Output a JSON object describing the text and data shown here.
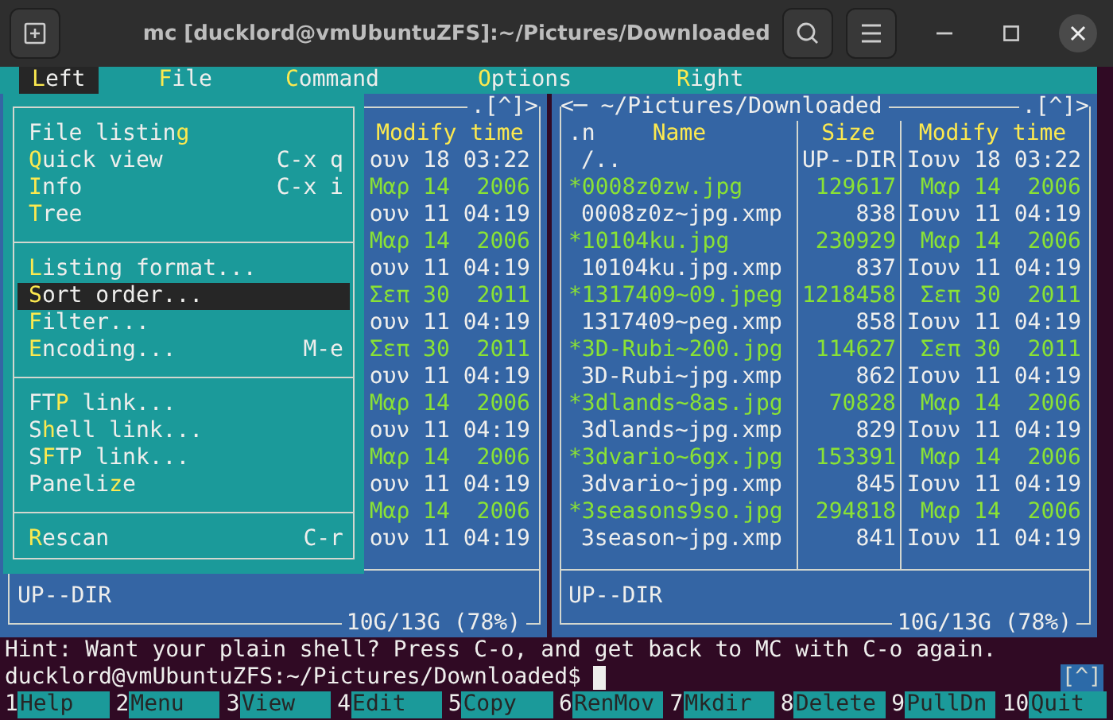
{
  "window": {
    "title": "mc [ducklord@vmUbuntuZFS]:~/Pictures/Downloaded"
  },
  "menu_bar": [
    {
      "hotkey": "L",
      "after": "eft",
      "selected": true
    },
    {
      "hotkey": "F",
      "after": "ile",
      "selected": false
    },
    {
      "hotkey": "C",
      "after": "ommand",
      "selected": false
    },
    {
      "hotkey": "O",
      "after": "ptions",
      "selected": false
    },
    {
      "hotkey": "R",
      "after": "ight",
      "selected": false
    }
  ],
  "dropdown": {
    "groups": [
      [
        {
          "before": "File listin",
          "hotkey": "g",
          "selected": false
        },
        {
          "hotkey": "Q",
          "after": "uick view",
          "shortcut": "C-x q",
          "selected": false
        },
        {
          "hotkey": "I",
          "after": "nfo",
          "shortcut": "C-x i",
          "selected": false
        },
        {
          "hotkey": "T",
          "after": "ree",
          "selected": false
        }
      ],
      [
        {
          "hotkey": "L",
          "after": "isting format...",
          "selected": false
        },
        {
          "hotkey": "S",
          "after": "ort order...",
          "selected": true
        },
        {
          "hotkey": "F",
          "after": "ilter...",
          "selected": false
        },
        {
          "hotkey": "E",
          "after": "ncoding...",
          "shortcut": "M-e",
          "selected": false
        }
      ],
      [
        {
          "before": "FT",
          "hotkey": "P",
          "after": " link...",
          "selected": false
        },
        {
          "before": "S",
          "hotkey": "h",
          "after": "ell link...",
          "selected": false
        },
        {
          "before": "S",
          "hotkey": "F",
          "after": "TP link...",
          "selected": false
        },
        {
          "before": "Paneli",
          "hotkey": "z",
          "after": "e",
          "selected": false
        }
      ],
      [
        {
          "hotkey": "R",
          "after": "escan",
          "shortcut": "C-r",
          "selected": false
        }
      ]
    ]
  },
  "left_panel": {
    "top_right": ".[^]>",
    "column_header": "Modify time",
    "rows": [
      {
        "date": "ουν 18 03:22",
        "marked": false
      },
      {
        "date": "Μαρ 14  2006",
        "marked": true
      },
      {
        "date": "ουν 11 04:19",
        "marked": false
      },
      {
        "date": "Μαρ 14  2006",
        "marked": true
      },
      {
        "date": "ουν 11 04:19",
        "marked": false
      },
      {
        "date": "Σεπ 30  2011",
        "marked": true
      },
      {
        "date": "ουν 11 04:19",
        "marked": false
      },
      {
        "date": "Σεπ 30  2011",
        "marked": true
      },
      {
        "date": "ουν 11 04:19",
        "marked": false
      },
      {
        "date": "Μαρ 14  2006",
        "marked": true
      },
      {
        "date": "ουν 11 04:19",
        "marked": false
      },
      {
        "date": "Μαρ 14  2006",
        "marked": true
      },
      {
        "date": "ουν 11 04:19",
        "marked": false
      },
      {
        "date": "Μαρ 14  2006",
        "marked": true
      },
      {
        "date": "ουν 11 04:19",
        "marked": false
      }
    ],
    "mini_status": "UP--DIR",
    "disk_usage": "10G/13G (78%)"
  },
  "right_panel": {
    "path": "<─ ~/Pictures/Downloaded",
    "top_right": ".[^]>",
    "columns": [
      {
        "sort_marker": ".n",
        "label": "Name"
      },
      {
        "label": "Size"
      },
      {
        "label": "Modify time"
      }
    ],
    "rows": [
      {
        "name": "/..",
        "size": "UP--DIR",
        "date": "Ιουν 18 03:22",
        "marked": false
      },
      {
        "name": "*0008z0zw.jpg",
        "size": "129617",
        "date": "Μαρ 14  2006",
        "marked": true
      },
      {
        "name": "0008z0z~jpg.xmp",
        "size": "838",
        "date": "Ιουν 11 04:19",
        "marked": false
      },
      {
        "name": "*10104ku.jpg",
        "size": "230929",
        "date": "Μαρ 14  2006",
        "marked": true
      },
      {
        "name": "10104ku.jpg.xmp",
        "size": "837",
        "date": "Ιουν 11 04:19",
        "marked": false
      },
      {
        "name": "*1317409~09.jpeg",
        "size": "1218458",
        "date": "Σεπ 30  2011",
        "marked": true
      },
      {
        "name": "1317409~peg.xmp",
        "size": "858",
        "date": "Ιουν 11 04:19",
        "marked": false
      },
      {
        "name": "*3D-Rubi~200.jpg",
        "size": "114627",
        "date": "Σεπ 30  2011",
        "marked": true
      },
      {
        "name": "3D-Rubi~jpg.xmp",
        "size": "862",
        "date": "Ιουν 11 04:19",
        "marked": false
      },
      {
        "name": "*3dlands~8as.jpg",
        "size": "70828",
        "date": "Μαρ 14  2006",
        "marked": true
      },
      {
        "name": "3dlands~jpg.xmp",
        "size": "829",
        "date": "Ιουν 11 04:19",
        "marked": false
      },
      {
        "name": "*3dvario~6gx.jpg",
        "size": "153391",
        "date": "Μαρ 14  2006",
        "marked": true
      },
      {
        "name": "3dvario~jpg.xmp",
        "size": "845",
        "date": "Ιουν 11 04:19",
        "marked": false
      },
      {
        "name": "*3seasons9so.jpg",
        "size": "294818",
        "date": "Μαρ 14  2006",
        "marked": true
      },
      {
        "name": "3season~jpg.xmp",
        "size": "841",
        "date": "Ιουν 11 04:19",
        "marked": false
      }
    ],
    "mini_status": "UP--DIR",
    "disk_usage": "10G/13G (78%)"
  },
  "hint": "Hint: Want your plain shell? Press C-o, and get back to MC with C-o again.",
  "prompt": {
    "text": "ducklord@vmUbuntuZFS:~/Pictures/Downloaded$",
    "scroll_marker": "[^]"
  },
  "function_keys": [
    {
      "number": "1",
      "label": "Help"
    },
    {
      "number": "2",
      "label": "Menu"
    },
    {
      "number": "3",
      "label": "View"
    },
    {
      "number": "4",
      "label": "Edit"
    },
    {
      "number": "5",
      "label": "Copy"
    },
    {
      "number": "6",
      "label": "RenMov"
    },
    {
      "number": "7",
      "label": "Mkdir"
    },
    {
      "number": "8",
      "label": "Delete"
    },
    {
      "number": "9",
      "label": "PullDn"
    },
    {
      "number": "10",
      "label": "Quit"
    }
  ]
}
